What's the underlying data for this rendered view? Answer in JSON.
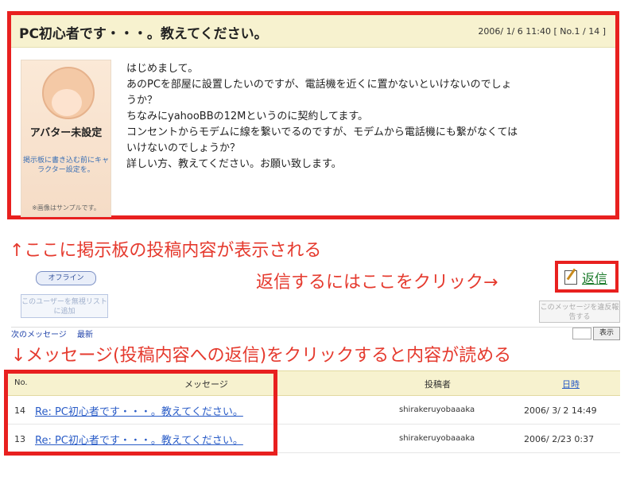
{
  "post": {
    "title": "PC初心者です・・・。教えてください。",
    "meta": "2006/ 1/ 6 11:40 [ No.1 / 14 ]",
    "avatar": {
      "label": "アバター未設定",
      "note": "掲示板に書き込む前にキャラクター設定を。",
      "sample": "※画像はサンプルです。"
    },
    "body": [
      "はじめまして。",
      "あのPCを部屋に設置したいのですが、電話機を近くに置かないといけないのでしょ",
      "うか？",
      "ちなみにyahooBBの12Mというのに契約してます。",
      "コンセントからモデムに線を繋いでるのですが、モデムから電話機にも繋がなくては",
      "いけないのでしょうか？",
      "詳しい方、教えてください。お願い致します。"
    ]
  },
  "annotations": {
    "post_content": "↑ここに掲示板の投稿内容が表示される",
    "reply_hint": "返信するにはここをクリック→",
    "message_hint": "↓メッセージ(投稿内容への返信)をクリックすると内容が読める"
  },
  "controls": {
    "offline_badge": "オフライン",
    "reply": "返信",
    "block_user": "このユーザーを無視リストに追加",
    "report": "このメッセージを違反報告する",
    "display": "表示",
    "nav_next": "次のメッセージ",
    "nav_latest": "最新"
  },
  "message_list": {
    "headers": {
      "no": "No.",
      "message": "メッセージ",
      "author": "投稿者",
      "date": "日時"
    },
    "rows": [
      {
        "no": "14",
        "message": "Re: PC初心者です・・・。教えてください。",
        "author": "shirakeruyobaaaka",
        "date": "2006/ 3/ 2 14:49"
      },
      {
        "no": "13",
        "message": "Re: PC初心者です・・・。教えてください。",
        "author": "shirakeruyobaaaka",
        "date": "2006/ 2/23  0:37"
      }
    ]
  },
  "colors": {
    "highlight": "#e8201f",
    "annotation": "#e53a2e",
    "header_bg": "#f7f2cf",
    "link": "#2a5cc7",
    "reply_link": "#1a7a2a"
  }
}
